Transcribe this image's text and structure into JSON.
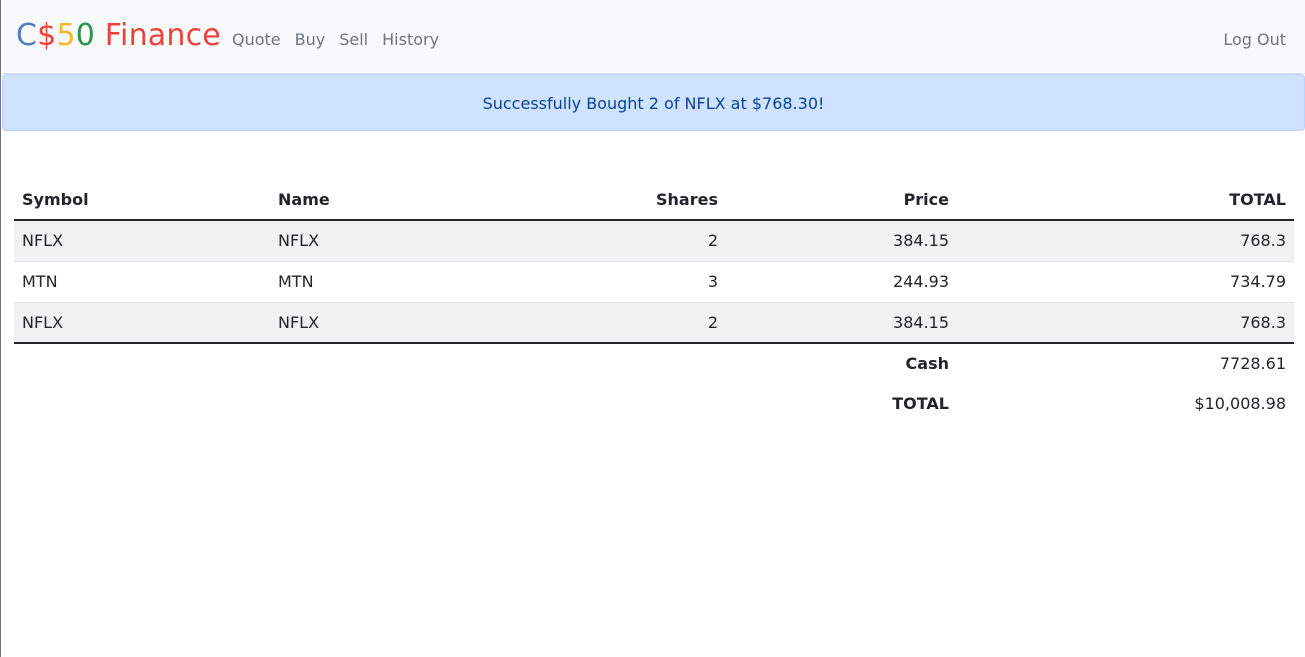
{
  "brand": {
    "parts": [
      {
        "text": "C",
        "color": "#537fbe"
      },
      {
        "text": "$",
        "color": "#ea433b"
      },
      {
        "text": "5",
        "color": "#f5b82e"
      },
      {
        "text": "0",
        "color": "#2e944b"
      },
      {
        "text": " Finance",
        "color": "#ea433b"
      }
    ]
  },
  "nav": {
    "links": [
      "Quote",
      "Buy",
      "Sell",
      "History"
    ],
    "logout": "Log Out"
  },
  "alert": {
    "message": "Successfully Bought 2 of NFLX at $768.30!"
  },
  "table": {
    "headers": [
      "Symbol",
      "Name",
      "Shares",
      "Price",
      "TOTAL"
    ],
    "rows": [
      [
        "NFLX",
        "NFLX",
        "2",
        "384.15",
        "768.3"
      ],
      [
        "MTN",
        "MTN",
        "3",
        "244.93",
        "734.79"
      ],
      [
        "NFLX",
        "NFLX",
        "2",
        "384.15",
        "768.3"
      ]
    ],
    "footer": {
      "cash_label": "Cash",
      "cash_value": "7728.61",
      "total_label": "TOTAL",
      "total_value": "$10,008.98"
    }
  }
}
